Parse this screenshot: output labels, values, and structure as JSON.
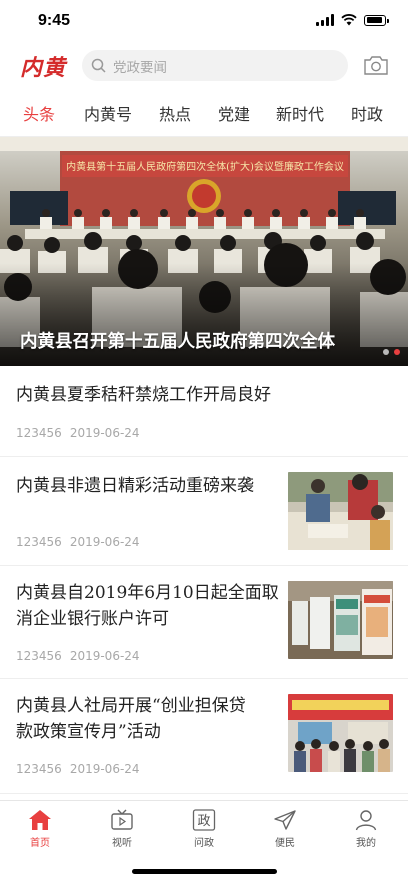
{
  "status_bar": {
    "time": "9:45"
  },
  "header": {
    "logo": "内黄",
    "search_placeholder": "党政要闻",
    "camera_icon": "camera-icon"
  },
  "tabs": [
    {
      "label": "头条",
      "active": true
    },
    {
      "label": "内黄号",
      "active": false
    },
    {
      "label": "热点",
      "active": false
    },
    {
      "label": "党建",
      "active": false
    },
    {
      "label": "新时代",
      "active": false
    },
    {
      "label": "时政",
      "active": false
    }
  ],
  "banner": {
    "caption": "内黄县召开第十五届人民政府第四次全体",
    "slide_count": 2,
    "active_slide": 1
  },
  "news": [
    {
      "title": "内黄县夏季秸秆禁烧工作开局良好",
      "source": "123456",
      "date": "2019-06-24",
      "has_thumb": false
    },
    {
      "title": "内黄县非遗日精彩活动重磅来袭",
      "source": "123456",
      "date": "2019-06-24",
      "has_thumb": true
    },
    {
      "title_line1": "内黄县自2019年6月10日起全面取",
      "title_line2": "消企业银行账户许可",
      "source": "123456",
      "date": "2019-06-24",
      "has_thumb": true
    },
    {
      "title_line1": "内黄县人社局开展“创业担保贷",
      "title_line2": "款政策宣传月”活动",
      "source": "123456",
      "date": "2019-06-24",
      "has_thumb": true
    }
  ],
  "tabbar": [
    {
      "label": "首页",
      "icon": "home-icon",
      "active": true
    },
    {
      "label": "视听",
      "icon": "tv-icon",
      "active": false
    },
    {
      "label": "问政",
      "icon": "zheng-icon",
      "active": false
    },
    {
      "label": "便民",
      "icon": "send-icon",
      "active": false
    },
    {
      "label": "我的",
      "icon": "user-icon",
      "active": false
    }
  ],
  "colors": {
    "accent": "#e84040",
    "logo": "#d42b2b"
  }
}
